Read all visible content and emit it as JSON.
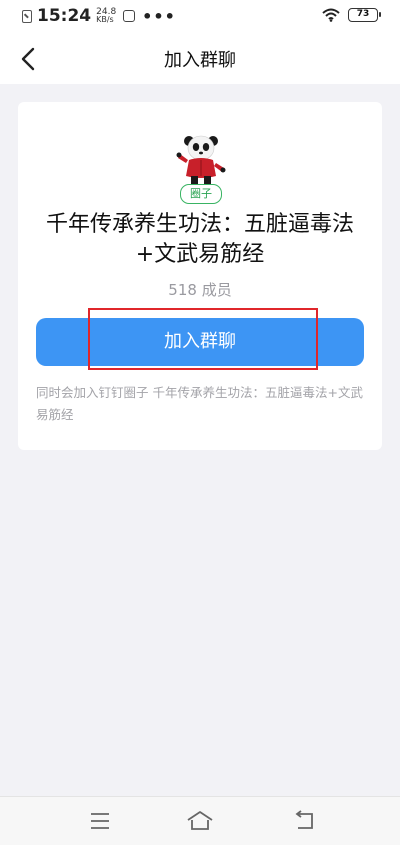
{
  "status_bar": {
    "time": "15:24",
    "speed_value": "24.8",
    "speed_unit": "KB/s",
    "more": "•••",
    "battery": "73"
  },
  "nav": {
    "title": "加入群聊",
    "back_icon": "chevron-left-icon"
  },
  "card": {
    "badge": "圈子",
    "title": "千年传承养生功法：五脏逼毒法+文武易筋经",
    "members": "518 成员",
    "join_label": "加入群聊",
    "note": "同时会加入钉钉圈子 千年传承养生功法：五脏逼毒法+文武易筋经"
  },
  "system_nav": {
    "menu_icon": "menu-icon",
    "home_icon": "home-icon",
    "back_icon": "back-arrow-icon"
  },
  "colors": {
    "primary": "#3d95f4",
    "highlight": "#e0262b",
    "badge": "#39b463"
  }
}
